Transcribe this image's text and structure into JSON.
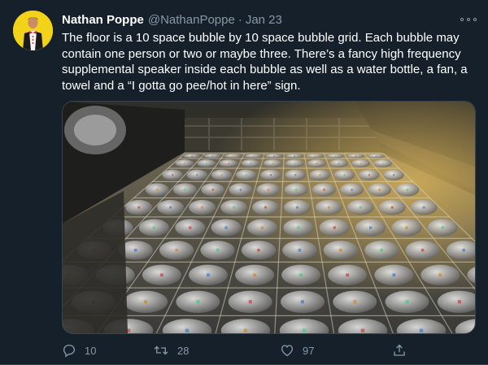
{
  "tweet": {
    "display_name": "Nathan Poppe",
    "handle": "@NathanPoppe",
    "separator": "·",
    "date": "Jan 23",
    "text": "The floor is a 10 space bubble by 10 space bubble grid. Each bubble may contain one person or two or maybe three. There’s a fancy high frequency supplemental speaker inside each bubble as well as a water bottle, a fan, a towel and a “I gotta go pee/hot in here” sign.",
    "media": {
      "grid_rows": 10,
      "grid_cols": 10
    },
    "actions": {
      "reply_count": "10",
      "retweet_count": "28",
      "like_count": "97"
    }
  },
  "icons": {
    "more": "more-horizontal-icon",
    "reply": "reply-icon",
    "retweet": "retweet-icon",
    "like": "heart-icon",
    "share": "share-icon"
  },
  "colors": {
    "background": "#15202b",
    "secondary_text": "#8899a6",
    "border": "#38444d",
    "avatar_bg": "#f2d31a"
  }
}
